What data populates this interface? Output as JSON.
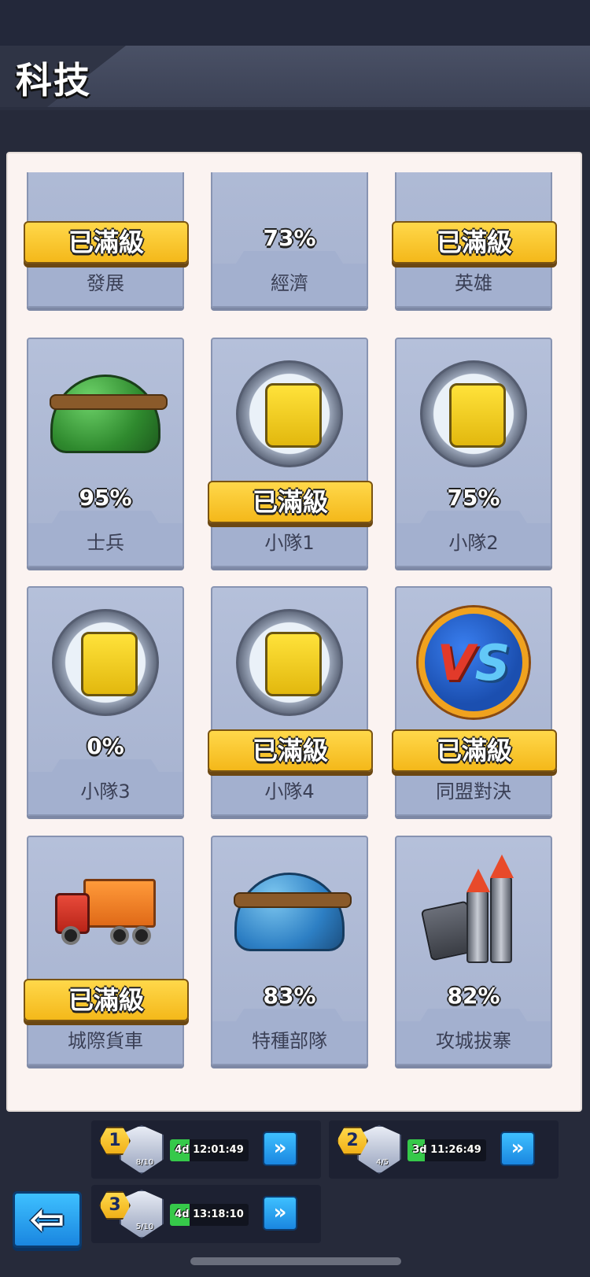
{
  "header": {
    "title": "科技"
  },
  "tech_cards": [
    {
      "name": "發展",
      "percent": "",
      "maxed": true,
      "max_label": "已滿級",
      "icon": "building-icon"
    },
    {
      "name": "經濟",
      "percent": "73%",
      "maxed": false,
      "max_label": "",
      "icon": "economy-arrows-icon"
    },
    {
      "name": "英雄",
      "percent": "",
      "maxed": true,
      "max_label": "已滿級",
      "icon": "hero-timer-icon"
    },
    {
      "name": "士兵",
      "percent": "95%",
      "maxed": false,
      "max_label": "",
      "icon": "green-helmets-icon"
    },
    {
      "name": "小隊1",
      "percent": "",
      "maxed": true,
      "max_label": "已滿級",
      "icon": "tank-squad-icon"
    },
    {
      "name": "小隊2",
      "percent": "75%",
      "maxed": false,
      "max_label": "",
      "icon": "tank-squad-icon"
    },
    {
      "name": "小隊3",
      "percent": "0%",
      "maxed": false,
      "max_label": "",
      "icon": "tank-squad-icon"
    },
    {
      "name": "小隊4",
      "percent": "",
      "maxed": true,
      "max_label": "已滿級",
      "icon": "tank-squad-icon"
    },
    {
      "name": "同盟對決",
      "percent": "",
      "maxed": true,
      "max_label": "已滿級",
      "icon": "vs-icon"
    },
    {
      "name": "城際貨車",
      "percent": "",
      "maxed": true,
      "max_label": "已滿級",
      "icon": "truck-icon"
    },
    {
      "name": "特種部隊",
      "percent": "83%",
      "maxed": false,
      "max_label": "",
      "icon": "blue-helmets-icon"
    },
    {
      "name": "攻城拔寨",
      "percent": "82%",
      "maxed": false,
      "max_label": "",
      "icon": "rockets-icon"
    }
  ],
  "builders": [
    {
      "num": "1",
      "capacity": "8/10",
      "timer": "4d 12:01:49",
      "progress": 0.25,
      "speed_icon": "fast-forward-icon"
    },
    {
      "num": "2",
      "capacity": "4/5",
      "timer": "3d 11:26:49",
      "progress": 0.22,
      "speed_icon": "fast-forward-icon"
    },
    {
      "num": "3",
      "capacity": "5/10",
      "timer": "4d 13:18:10",
      "progress": 0.25,
      "speed_icon": "fast-forward-icon"
    }
  ],
  "colors": {
    "background": "#262a3a",
    "panel": "#fbf3f1",
    "card": "#aab5d2",
    "max_badge": "#f4b81a",
    "timer_fill": "#36c94a",
    "button_blue": "#1a86e0"
  },
  "icons": {
    "back": "back-arrow-icon",
    "speedup": "fast-forward-icon"
  }
}
